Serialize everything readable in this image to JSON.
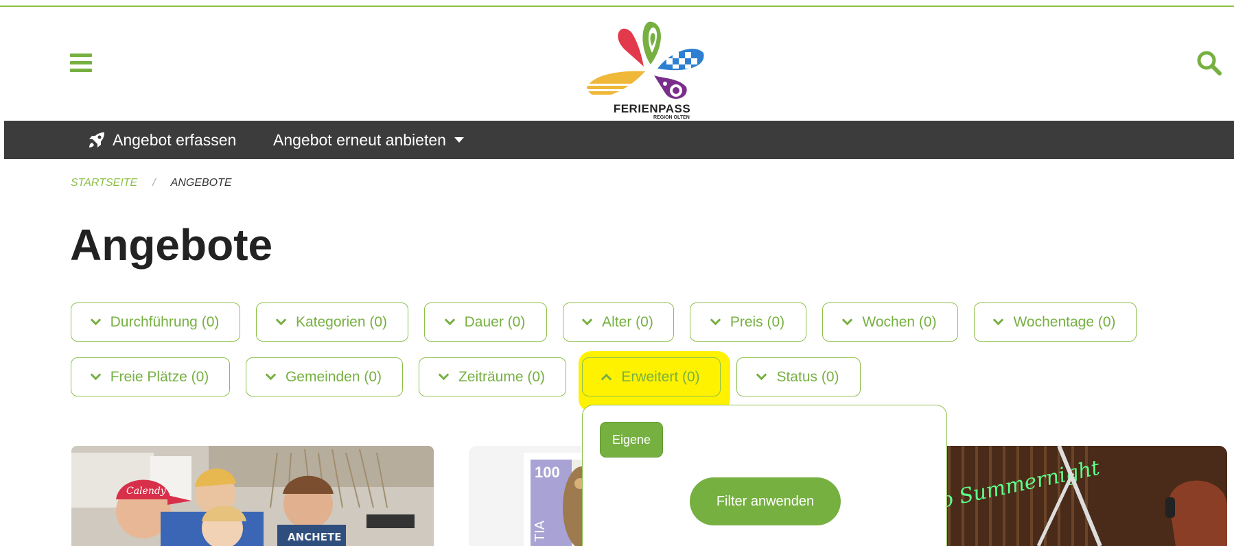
{
  "logo": {
    "title": "FERIENPASS",
    "subtitle": "REGION OLTEN",
    "colors": [
      "#e23a4c",
      "#76b041",
      "#2d7fd2",
      "#efb839",
      "#7a2e8c"
    ]
  },
  "header": {
    "menu_icon": "hamburger-icon",
    "search_icon": "search-icon"
  },
  "nav": {
    "items": [
      {
        "label": "Angebot erfassen",
        "icon": "rocket-icon"
      },
      {
        "label": "Angebot erneut anbieten",
        "icon": "caret-down-icon"
      }
    ]
  },
  "breadcrumb": {
    "home": "STARTSEITE",
    "separator": "/",
    "current": "ANGEBOTE"
  },
  "page_title": "Angebote",
  "filters": {
    "row1": [
      "Durchführung (0)",
      "Kategorien (0)",
      "Dauer (0)",
      "Alter (0)",
      "Preis (0)",
      "Wochen (0)",
      "Wochentage (0)"
    ],
    "row2": [
      "Freie Plätze (0)",
      "Gemeinden (0)",
      "Zeiträume (0)",
      "Erweitert (0)",
      "Status (0)"
    ],
    "active": "Erweitert (0)"
  },
  "dropdown": {
    "tag": "Eigene",
    "apply": "Filter anwenden"
  },
  "cards": {
    "card2_stamp_value": "100",
    "card2_stamp_text": "TIA",
    "card2_neon_text": "o Summernight"
  },
  "colors": {
    "accent": "#76b041",
    "accent_light": "#8dc04a",
    "navbar": "#3c3c3c",
    "highlight": "#fff200"
  }
}
